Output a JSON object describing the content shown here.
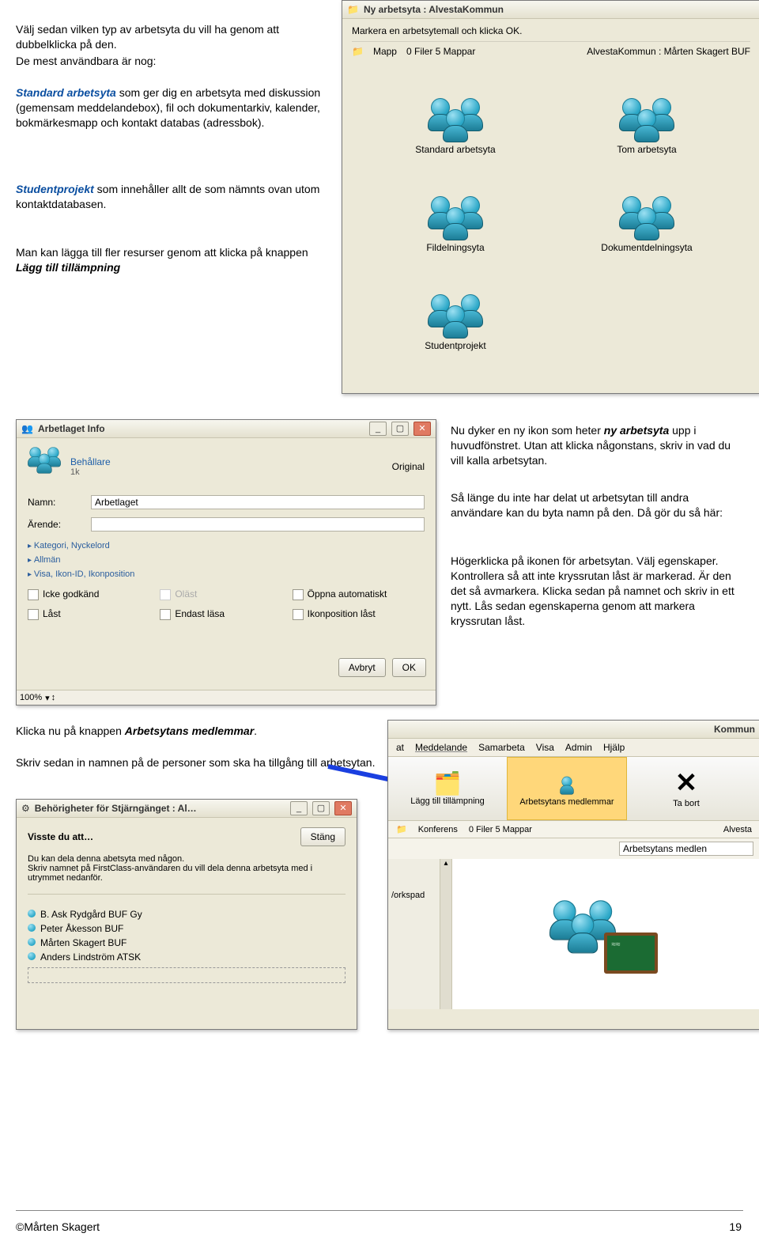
{
  "intro": {
    "p1": "Välj sedan vilken typ av arbetsyta du vill ha genom att dubbelklicka på den.",
    "p2": "De mest användbara är nog:",
    "std_label": "Standard arbetsyta",
    "std_rest": " som ger dig en arbetsyta med diskussion (gemensam meddelandebox), fil och dokumentarkiv, kalender, bokmärkesmapp och kontakt databas (adressbok).",
    "stud_label": "Studentprojekt",
    "stud_rest": " som innehåller allt de som nämnts ovan utom kontaktdatabasen.",
    "p3a": "Man kan lägga till fler resurser genom att klicka på knappen ",
    "p3b": "Lägg till tillämpning"
  },
  "ws_window": {
    "title": "Ny arbetsyta : AlvestaKommun",
    "instruction": "Markera en arbetsytemall och klicka OK.",
    "breadcrumb_folder": "Mapp",
    "breadcrumb_stats": "0 Filer  5 Mappar",
    "breadcrumb_path": "AlvestaKommun : Mårten Skagert BUF",
    "cells": [
      "Standard arbetsyta",
      "Tom arbetsyta",
      "Fildelningsyta",
      "Dokumentdelningsyta",
      "Studentprojekt"
    ]
  },
  "info_win": {
    "title": "Arbetlaget Info",
    "container": "Behållare",
    "container_sub": "1k",
    "original": "Original",
    "name_label": "Namn:",
    "name_value": "Arbetlaget",
    "subject_label": "Ärende:",
    "exp1": "Kategori, Nyckelord",
    "exp2": "Allmän",
    "exp3": "Visa, Ikon-ID, Ikonposition",
    "chk1": "Icke godkänd",
    "chk2": "Låst",
    "chk3": "Oläst",
    "chk4": "Endast läsa",
    "chk5": "Öppna automatiskt",
    "chk6": "Ikonposition låst",
    "cancel": "Avbryt",
    "ok": "OK",
    "zoom": "100%"
  },
  "mid_right": {
    "l1a": "Nu dyker en ny ikon som heter ",
    "l1b": "ny arbetsyta",
    "l1c": " upp i huvudfönstret. Utan att klicka någonstans, skriv in vad du vill kalla arbetsytan.",
    "l2": "Så länge du inte har delat ut arbetsytan till andra användare kan du byta namn på den. Då gör du så här:",
    "l3": "Högerklicka på ikonen för arbetsytan. Välj egenskaper. Kontrollera så att inte kryssrutan låst är markerad. Är den det så avmarkera. Klicka sedan på namnet och skriv in ett nytt. Lås sedan egenskaperna genom att markera kryssrutan låst."
  },
  "mid_lower": {
    "l1a": "Klicka nu på knappen ",
    "l1b": "Arbetsytans medlemmar",
    "l1c": ".",
    "l2": "Skriv sedan in namnen på de personer som ska ha tillgång till arbetsytan."
  },
  "perm_win": {
    "title": "Behörigheter för Stjärngänget : Al…",
    "dyk_label": "Visste du att…",
    "close_btn": "Stäng",
    "help1": "Du kan dela denna abetsyta med någon.",
    "help2": "Skriv namnet på FirstClass-användaren du vill dela denna arbetsyta med i utrymmet nedanför.",
    "users": [
      "B. Ask Rydgård BUF Gy",
      "Peter Åkesson BUF",
      "Mårten Skagert BUF",
      "Anders Lindström ATSK"
    ]
  },
  "toolbar_win": {
    "title_word": "Kommun",
    "menu": [
      "at",
      "Meddelande",
      "Samarbeta",
      "Visa",
      "Admin",
      "Hjälp"
    ],
    "items": [
      "Lägg till tillämpning",
      "Arbetsytans medlemmar",
      "Ta bort"
    ],
    "crumb_left": "Konferens",
    "crumb_mid": "0 Filer  5 Mappar",
    "crumb_right": "Alvesta",
    "input_preview": "Arbetsytans medlen",
    "left_cut": "/orkspad"
  },
  "footer": {
    "author": "©Mårten Skagert",
    "page": "19"
  }
}
